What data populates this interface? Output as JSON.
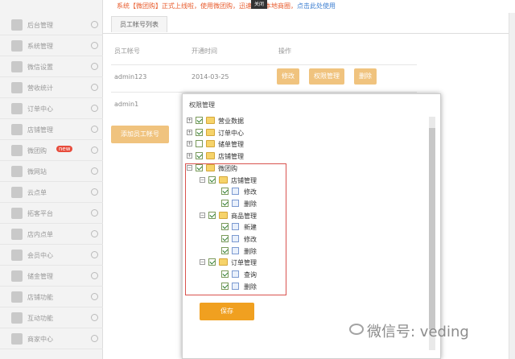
{
  "notice": {
    "text": "系统【微团购】正式上线啦，使用微团购，迅速打造本地商圈，",
    "link": "点击此处使用"
  },
  "sidebar": {
    "items": [
      {
        "label": "后台管理"
      },
      {
        "label": "系统管理"
      },
      {
        "label": "微信设置"
      },
      {
        "label": "营收统计"
      },
      {
        "label": "订单中心"
      },
      {
        "label": "店铺管理"
      },
      {
        "label": "微团购",
        "badge": "new"
      },
      {
        "label": "微网站"
      },
      {
        "label": "云点单"
      },
      {
        "label": "拓客平台"
      },
      {
        "label": "店内点单"
      },
      {
        "label": "会员中心"
      },
      {
        "label": "储金管理"
      },
      {
        "label": "店铺功能"
      },
      {
        "label": "互动功能"
      },
      {
        "label": "商家中心"
      }
    ]
  },
  "tab": {
    "label": "员工帐号列表"
  },
  "table": {
    "headers": [
      "员工帐号",
      "开通时间",
      "操作"
    ],
    "rows": [
      {
        "account": "admin123",
        "time": "2014-03-25",
        "actions": [
          "修改",
          "权限管理",
          "删除"
        ]
      },
      {
        "account": "admin1",
        "time": "",
        "actions": []
      }
    ],
    "add_button": "添加员工帐号"
  },
  "modal": {
    "title": "权限管理",
    "close": "关闭",
    "save": "保存",
    "tree": [
      {
        "label": "营业数据",
        "level": 0,
        "checked": true,
        "type": "folder",
        "expander": "+"
      },
      {
        "label": "订单中心",
        "level": 0,
        "checked": true,
        "type": "folder",
        "expander": "+"
      },
      {
        "label": "储单管理",
        "level": 0,
        "checked": false,
        "type": "folder",
        "expander": "+"
      },
      {
        "label": "店铺管理",
        "level": 0,
        "checked": true,
        "type": "folder",
        "expander": "+"
      },
      {
        "label": "微团购",
        "level": 0,
        "checked": true,
        "type": "folder",
        "expander": "−"
      },
      {
        "label": "店铺管理",
        "level": 1,
        "checked": true,
        "type": "folder",
        "expander": "−"
      },
      {
        "label": "修改",
        "level": 2,
        "checked": true,
        "type": "page",
        "expander": ""
      },
      {
        "label": "删除",
        "level": 2,
        "checked": true,
        "type": "page",
        "expander": ""
      },
      {
        "label": "商品管理",
        "level": 1,
        "checked": true,
        "type": "folder",
        "expander": "−"
      },
      {
        "label": "新建",
        "level": 2,
        "checked": true,
        "type": "page",
        "expander": ""
      },
      {
        "label": "修改",
        "level": 2,
        "checked": true,
        "type": "page",
        "expander": ""
      },
      {
        "label": "删除",
        "level": 2,
        "checked": true,
        "type": "page",
        "expander": ""
      },
      {
        "label": "订单管理",
        "level": 1,
        "checked": true,
        "type": "folder",
        "expander": "−"
      },
      {
        "label": "查询",
        "level": 2,
        "checked": true,
        "type": "page",
        "expander": ""
      },
      {
        "label": "删除",
        "level": 2,
        "checked": true,
        "type": "page",
        "expander": ""
      }
    ]
  },
  "watermark": {
    "text": "微信号: veding"
  },
  "colors": {
    "accent": "#f0a020",
    "button": "#f0c37e",
    "highlight": "#d9534f",
    "notice": "#e85b2c"
  }
}
